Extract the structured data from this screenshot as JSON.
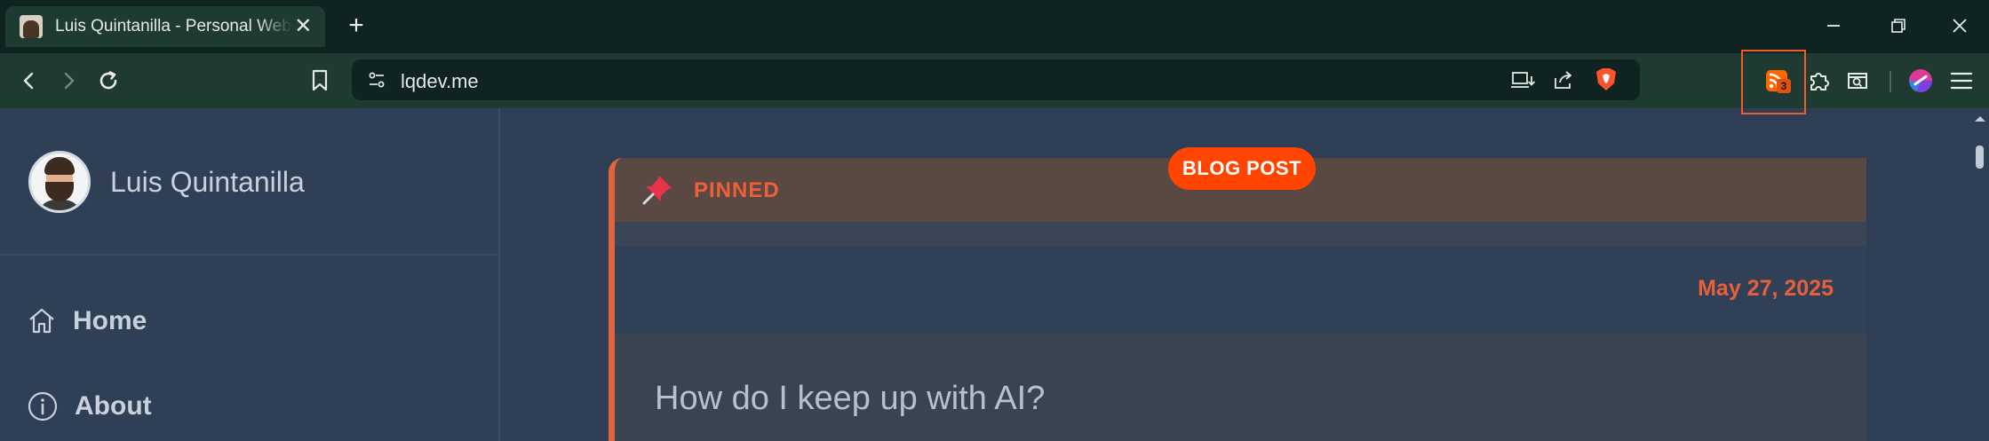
{
  "browser": {
    "tab": {
      "title": "Luis Quintanilla - Personal Website"
    },
    "address_bar": {
      "url": "lqdev.me"
    },
    "extensions": {
      "rss_badge_count": "3"
    }
  },
  "site": {
    "brand_name": "Luis Quintanilla",
    "nav": [
      {
        "label": "Home",
        "icon": "home-icon"
      },
      {
        "label": "About",
        "icon": "info-icon"
      }
    ]
  },
  "post": {
    "badge": "BLOG POST",
    "pinned_label": "PINNED",
    "date": "May 27, 2025",
    "title": "How do I keep up with AI?"
  },
  "colors": {
    "accent": "#e4633f",
    "badge": "#ff4500",
    "chrome": "#1e3a31",
    "page_bg": "#2e3e54"
  }
}
